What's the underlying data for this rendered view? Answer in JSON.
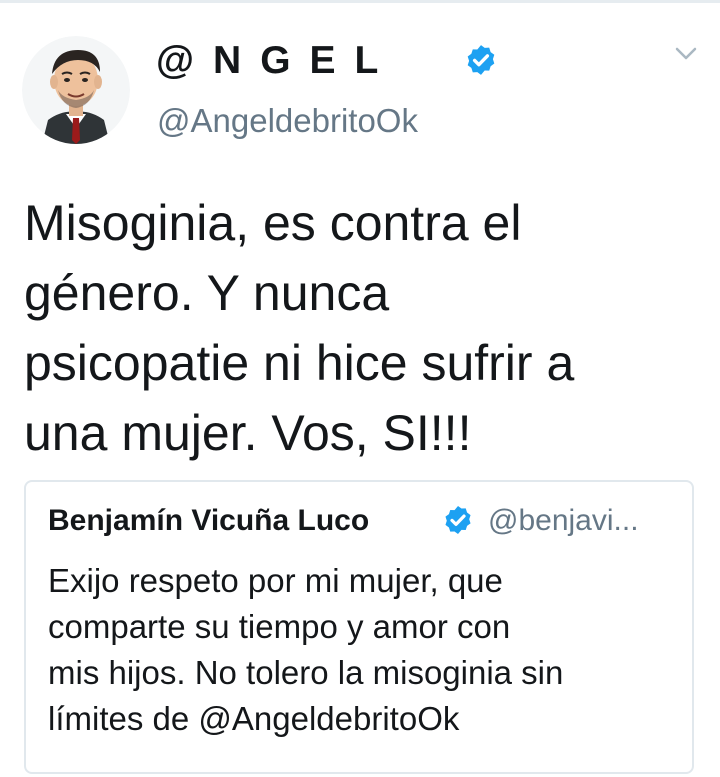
{
  "tweet": {
    "display_name": "@NGEL",
    "handle": "@AngeldebritoOk",
    "text": "Misoginia, es contra el\ngénero. Y nunca\npsicopatie ni hice sufrir a\nuna mujer. Vos, SI!!!",
    "verified": true,
    "avatar": "caricature-avatar",
    "menu_icon": "chevron-down-icon"
  },
  "quote": {
    "display_name": "Benjamín Vicuña Luco",
    "handle": "@benjavi...",
    "verified": true,
    "text": "Exijo respeto por mi mujer, que\ncomparte su tiempo y amor con\nmis hijos. No tolero la misoginia sin\nlímites de @AngeldebritoOk"
  },
  "colors": {
    "verified_blue": "#1da1f2",
    "secondary_text": "#657786",
    "primary_text": "#14171a",
    "border": "#e1e8ed"
  }
}
